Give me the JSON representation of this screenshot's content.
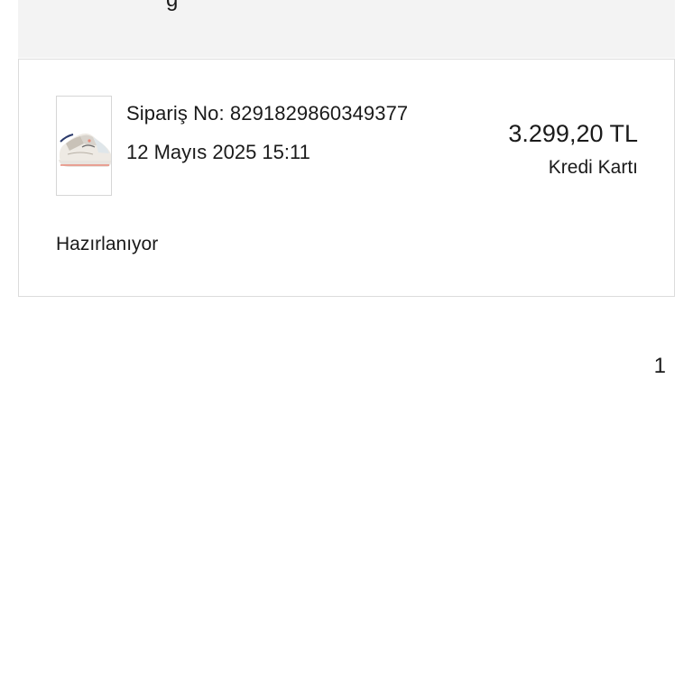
{
  "header": {
    "partial_glyph": "g"
  },
  "order": {
    "order_number_label": "Sipariş No: 8291829860349377",
    "date": "12 Mayıs 2025 15:11",
    "total": "3.299,20 TL",
    "payment_method": "Kredi Kartı",
    "status": "Hazırlanıyor",
    "product_image_icon": "sneaker-image"
  },
  "pagination": {
    "current_page": "1"
  },
  "colors": {
    "header_band": "#f3f3f3",
    "card_border": "#dcdcdc",
    "text": "#1a1a1a"
  }
}
